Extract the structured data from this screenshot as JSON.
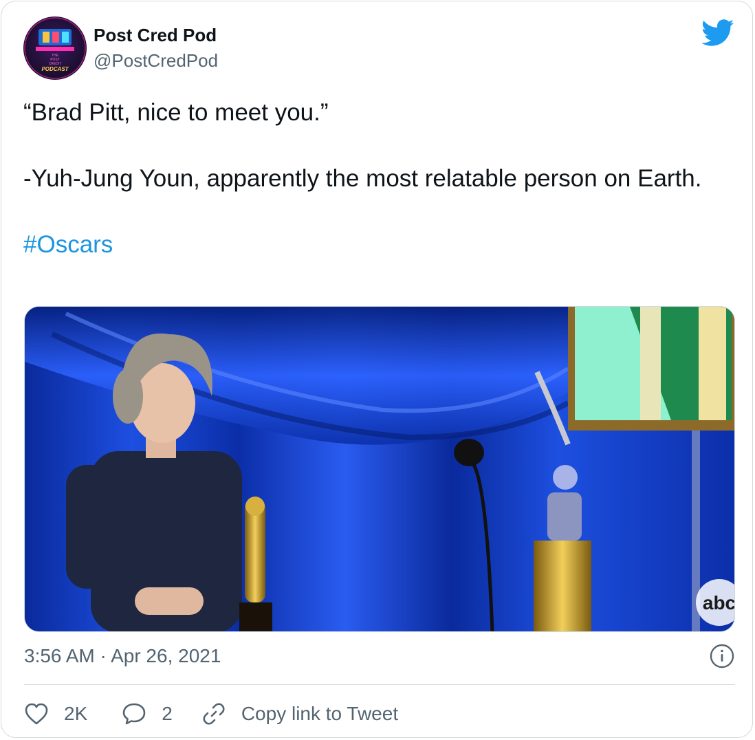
{
  "author": {
    "name": "Post Cred Pod",
    "handle": "@PostCredPod",
    "avatar_text": [
      "THE",
      "POST",
      "CREDIT",
      "PODCAST"
    ]
  },
  "logo_icon": "twitter-bird-icon",
  "tweet": {
    "line1": "“Brad Pitt, nice to meet you.”",
    "line2": "-Yuh-Jung Youn, apparently the most relatable person on Earth.",
    "hashtag": "#Oscars"
  },
  "media": {
    "watermark": "abc"
  },
  "timestamp": "3:56 AM · Apr 26, 2021",
  "actions": {
    "likes": "2K",
    "replies": "2",
    "copy_link": "Copy link to Tweet"
  },
  "colors": {
    "accent": "#1b95e0",
    "secondary_text": "#536471",
    "border": "#cfd9de"
  }
}
